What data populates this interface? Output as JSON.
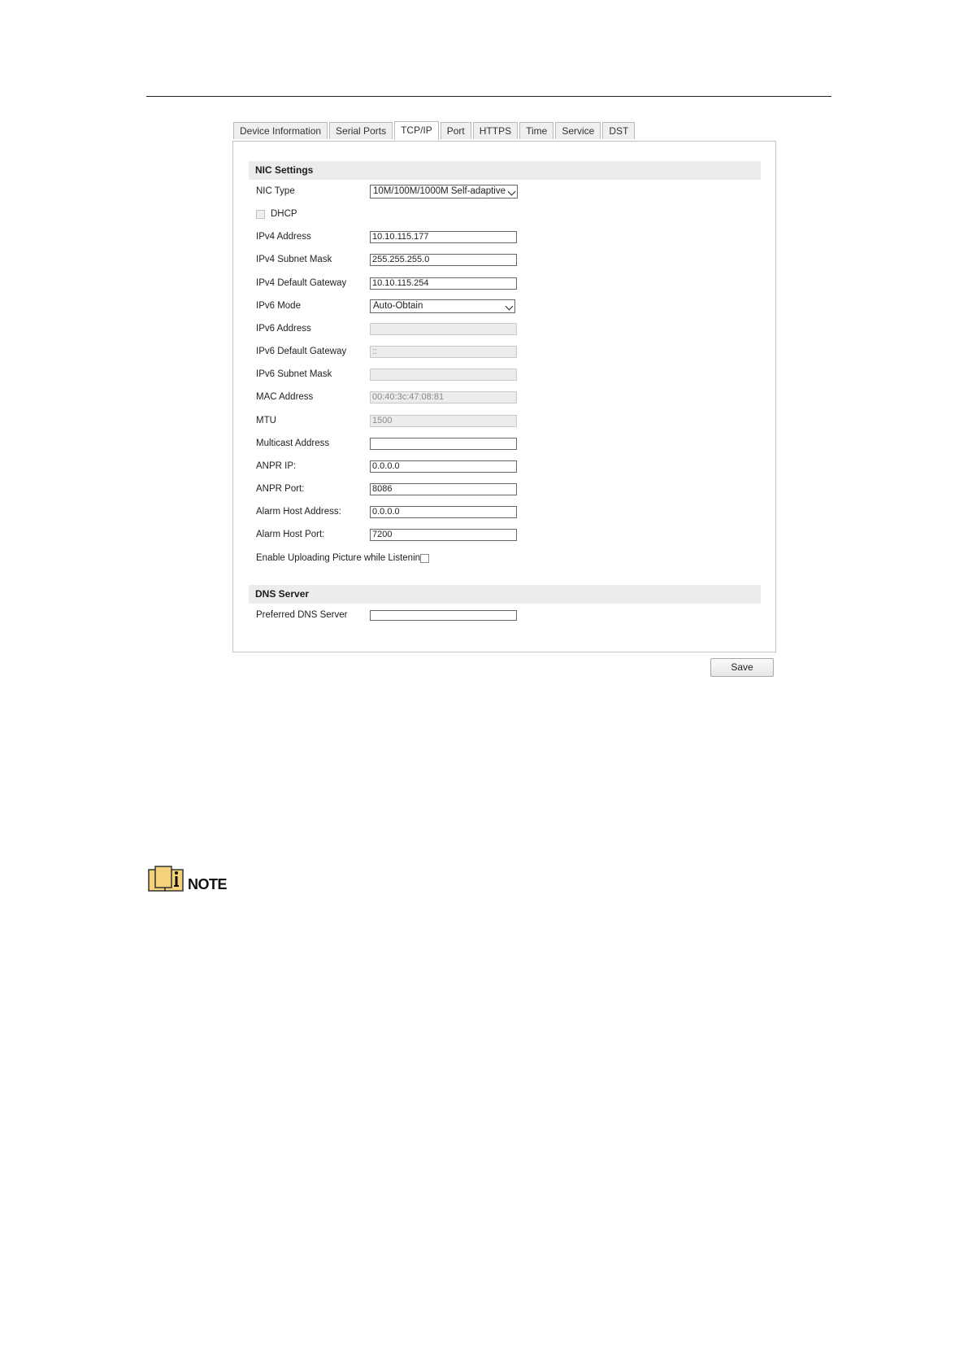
{
  "tabs": [
    {
      "label": "Device Information"
    },
    {
      "label": "Serial Ports"
    },
    {
      "label": "TCP/IP",
      "active": true
    },
    {
      "label": "Port"
    },
    {
      "label": "HTTPS"
    },
    {
      "label": "Time"
    },
    {
      "label": "Service"
    },
    {
      "label": "DST"
    }
  ],
  "nic_settings": {
    "title": "NIC Settings",
    "nic_type": {
      "label": "NIC Type",
      "value": "10M/100M/1000M Self-adaptive"
    },
    "dhcp": {
      "label": "DHCP",
      "checked": false
    },
    "ipv4_address": {
      "label": "IPv4 Address",
      "value": "10.10.115.177"
    },
    "ipv4_subnet_mask": {
      "label": "IPv4 Subnet Mask",
      "value": "255.255.255.0"
    },
    "ipv4_default_gateway": {
      "label": "IPv4 Default Gateway",
      "value": "10.10.115.254"
    },
    "ipv6_mode": {
      "label": "IPv6 Mode",
      "value": "Auto-Obtain"
    },
    "ipv6_address": {
      "label": "IPv6 Address",
      "value": ""
    },
    "ipv6_default_gateway": {
      "label": "IPv6 Default Gateway",
      "value": "::"
    },
    "ipv6_subnet_mask": {
      "label": "IPv6 Subnet Mask",
      "value": ""
    },
    "mac_address": {
      "label": "MAC Address",
      "value": "00:40:3c:47:08:81"
    },
    "mtu": {
      "label": "MTU",
      "value": "1500"
    },
    "multicast_address": {
      "label": "Multicast Address",
      "value": ""
    },
    "anpr_ip": {
      "label": "ANPR IP:",
      "value": "0.0.0.0"
    },
    "anpr_port": {
      "label": "ANPR Port:",
      "value": "8086"
    },
    "alarm_host_address": {
      "label": "Alarm Host Address:",
      "value": "0.0.0.0"
    },
    "alarm_host_port": {
      "label": "Alarm Host Port:",
      "value": "7200"
    },
    "enable_uploading": {
      "label": "Enable Uploading Picture while Listening:",
      "checked": false
    }
  },
  "dns_server": {
    "title": "DNS Server",
    "preferred_dns": {
      "label": "Preferred DNS Server",
      "value": ""
    }
  },
  "save_label": "Save",
  "note": {
    "label": "NOTE",
    "icon": "book-info-icon",
    "icon_color": "#f3d27a"
  }
}
